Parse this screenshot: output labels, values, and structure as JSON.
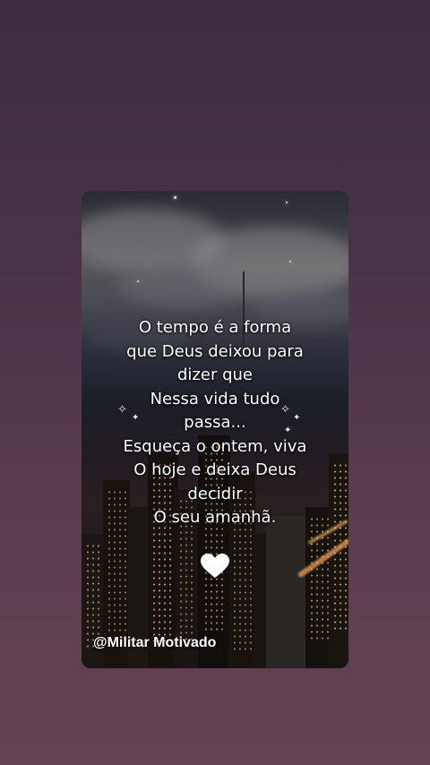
{
  "post": {
    "quote_lines": [
      "O tempo é a forma",
      "que Deus deixou para",
      "dizer que",
      "Nessa vida tudo",
      "passa...",
      "Esqueça o ontem, viva",
      "O hoje e deixa Deus",
      "decidir",
      "O seu amanhã."
    ],
    "heart_icon": "heart-icon",
    "handle": "@Militar Motivado"
  },
  "colors": {
    "background": "#4a3347",
    "text": "#ffffff",
    "heart": "#ffffff"
  }
}
